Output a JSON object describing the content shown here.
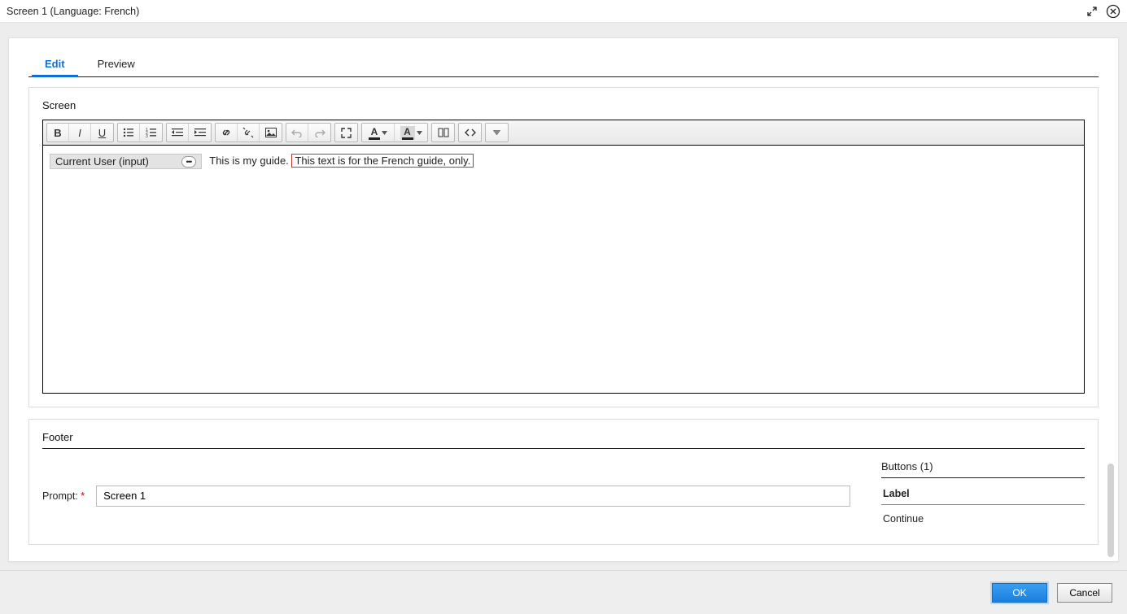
{
  "titlebar": {
    "title": "Screen 1 (Language: French)"
  },
  "tabs": {
    "edit": "Edit",
    "preview": "Preview"
  },
  "screen": {
    "heading": "Screen",
    "chip_label": "Current User (input)",
    "body_text": "This is my guide.",
    "highlighted_text": "This text is for the French guide, only."
  },
  "footer": {
    "heading": "Footer",
    "prompt_label": "Prompt:",
    "prompt_value": "Screen 1",
    "buttons_heading": "Buttons (1)",
    "label_header": "Label",
    "items": [
      "Continue"
    ]
  },
  "actions": {
    "ok": "OK",
    "cancel": "Cancel"
  }
}
